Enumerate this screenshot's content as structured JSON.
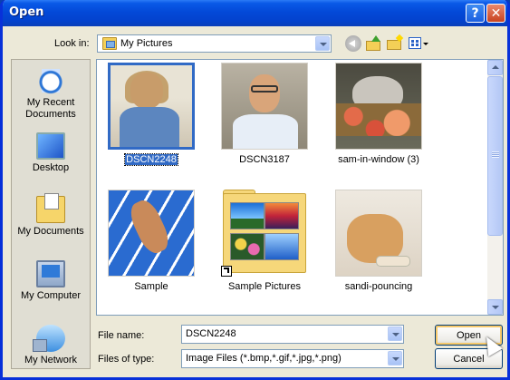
{
  "window": {
    "title": "Open",
    "help_label": "?",
    "close_label": "✕"
  },
  "toolbar": {
    "look_in_label": "Look in:",
    "look_in_value": "My Pictures",
    "icons": [
      "back-icon",
      "up-folder-icon",
      "new-folder-icon",
      "views-menu-icon"
    ]
  },
  "places": [
    {
      "label": "My Recent Documents",
      "icon": "recent-documents-icon"
    },
    {
      "label": "Desktop",
      "icon": "desktop-icon"
    },
    {
      "label": "My Documents",
      "icon": "my-documents-icon"
    },
    {
      "label": "My Computer",
      "icon": "my-computer-icon"
    },
    {
      "label": "My Network",
      "icon": "my-network-icon"
    }
  ],
  "files": [
    {
      "name": "DSCN2248",
      "selected": true
    },
    {
      "name": "DSCN3187"
    },
    {
      "name": "sam-in-window (3)"
    },
    {
      "name": "Sample"
    },
    {
      "name": "Sample Pictures",
      "type": "folder-shortcut"
    },
    {
      "name": "sandi-pouncing"
    }
  ],
  "file_name": {
    "label": "File name:",
    "value": "DSCN2248"
  },
  "file_type": {
    "label": "Files of type:",
    "value": "Image Files (*.bmp,*.gif,*.jpg,*.png)"
  },
  "buttons": {
    "open": "Open",
    "cancel": "Cancel"
  },
  "colors": {
    "title_bar": "#0a5ae8",
    "selection": "#316ac5",
    "dialog_bg": "#ece9d8"
  }
}
